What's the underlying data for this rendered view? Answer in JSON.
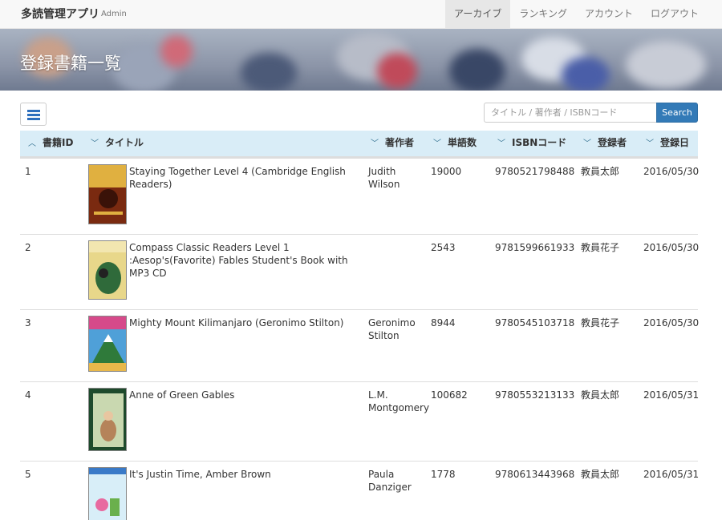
{
  "navbar": {
    "brand": "多読管理アプリ",
    "brand_sub": "Admin",
    "items": [
      {
        "label": "アーカイブ"
      },
      {
        "label": "ランキング"
      },
      {
        "label": "アカウント"
      },
      {
        "label": "ログアウト"
      }
    ]
  },
  "banner": {
    "title": "登録書籍一覧"
  },
  "toolbar": {
    "list_icon": "list-icon",
    "search_placeholder": "タイトル / 著作者 / ISBNコード",
    "search_label": "Search"
  },
  "table": {
    "headers": {
      "id": "書籍ID",
      "title": "タイトル",
      "author": "著作者",
      "words": "単語数",
      "isbn": "ISBNコード",
      "registrant": "登録者",
      "date": "登録日"
    },
    "rows": [
      {
        "id": "1",
        "title": "Staying Together Level 4 (Cambridge English Readers)",
        "author": "Judith Wilson",
        "words": "19000",
        "isbn": "9780521798488",
        "registrant": "教員太郎",
        "date": "2016/05/30",
        "cover_color": "#7a2a10",
        "cover_accent": "#e0b040"
      },
      {
        "id": "2",
        "title": "Compass Classic Readers Level 1 :Aesop's(Favorite) Fables Student's Book with MP3 CD",
        "author": "",
        "words": "2543",
        "isbn": "9781599661933",
        "registrant": "教員花子",
        "date": "2016/05/30",
        "cover_color": "#e8d78a",
        "cover_accent": "#2f6a3a"
      },
      {
        "id": "3",
        "title": "Mighty Mount Kilimanjaro (Geronimo Stilton)",
        "author": "Geronimo Stilton",
        "words": "8944",
        "isbn": "9780545103718",
        "registrant": "教員花子",
        "date": "2016/05/30",
        "cover_color": "#4fa0d8",
        "cover_accent": "#d64a8a"
      },
      {
        "id": "4",
        "title": "Anne of Green Gables",
        "author": "L.M. Montgomery",
        "words": "100682",
        "isbn": "9780553213133",
        "registrant": "教員太郎",
        "date": "2016/05/31",
        "cover_color": "#1e4a2c",
        "cover_accent": "#c9d8b0"
      },
      {
        "id": "5",
        "title": "It's Justin Time, Amber Brown",
        "author": "Paula Danziger",
        "words": "1778",
        "isbn": "9780613443968",
        "registrant": "教員太郎",
        "date": "2016/05/31",
        "cover_color": "#d8eef8",
        "cover_accent": "#e86aa0"
      }
    ]
  }
}
